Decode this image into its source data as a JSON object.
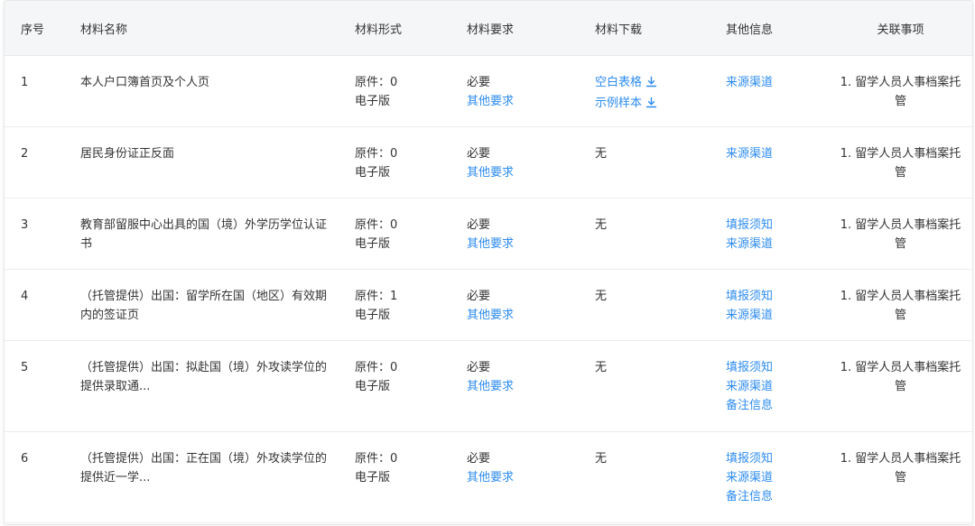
{
  "columns": [
    "序号",
    "材料名称",
    "材料形式",
    "材料要求",
    "材料下载",
    "其他信息",
    "关联事项"
  ],
  "rows": [
    {
      "index": "1",
      "name": "本人户口簿首页及个人页",
      "form": [
        "原件：0",
        "电子版"
      ],
      "requirement": {
        "text": "必要",
        "link": "其他要求"
      },
      "download": {
        "type": "links",
        "items": [
          "空白表格",
          "示例样本"
        ],
        "icon": "download-icon"
      },
      "other_info": [
        "来源渠道"
      ],
      "related": "1. 留学人员人事档案托管"
    },
    {
      "index": "2",
      "name": "居民身份证正反面",
      "form": [
        "原件：0",
        "电子版"
      ],
      "requirement": {
        "text": "必要",
        "link": "其他要求"
      },
      "download": {
        "type": "text",
        "text": "无"
      },
      "other_info": [
        "来源渠道"
      ],
      "related": "1. 留学人员人事档案托管"
    },
    {
      "index": "3",
      "name": "教育部留服中心出具的国（境）外学历学位认证书",
      "form": [
        "原件：0",
        "电子版"
      ],
      "requirement": {
        "text": "必要",
        "link": "其他要求"
      },
      "download": {
        "type": "text",
        "text": "无"
      },
      "other_info": [
        "填报须知",
        "来源渠道"
      ],
      "related": "1. 留学人员人事档案托管"
    },
    {
      "index": "4",
      "name": "（托管提供）出国：留学所在国（地区）有效期内的签证页",
      "form": [
        "原件：1",
        "电子版"
      ],
      "requirement": {
        "text": "必要",
        "link": "其他要求"
      },
      "download": {
        "type": "text",
        "text": "无"
      },
      "other_info": [
        "填报须知",
        "来源渠道"
      ],
      "related": "1. 留学人员人事档案托管"
    },
    {
      "index": "5",
      "name": "（托管提供）出国：拟赴国（境）外攻读学位的提供录取通...",
      "form": [
        "原件：0",
        "电子版"
      ],
      "requirement": {
        "text": "必要",
        "link": "其他要求"
      },
      "download": {
        "type": "text",
        "text": "无"
      },
      "other_info": [
        "填报须知",
        "来源渠道",
        "备注信息"
      ],
      "related": "1. 留学人员人事档案托管"
    },
    {
      "index": "6",
      "name": "（托管提供）出国：正在国（境）外攻读学位的提供近一学...",
      "form": [
        "原件：0",
        "电子版"
      ],
      "requirement": {
        "text": "必要",
        "link": "其他要求"
      },
      "download": {
        "type": "text",
        "text": "无"
      },
      "other_info": [
        "填报须知",
        "来源渠道",
        "备注信息"
      ],
      "related": "1. 留学人员人事档案托管"
    }
  ],
  "colors": {
    "link": "#2d8cf0",
    "header_bg": "#f5f6f8",
    "text": "#333333"
  }
}
